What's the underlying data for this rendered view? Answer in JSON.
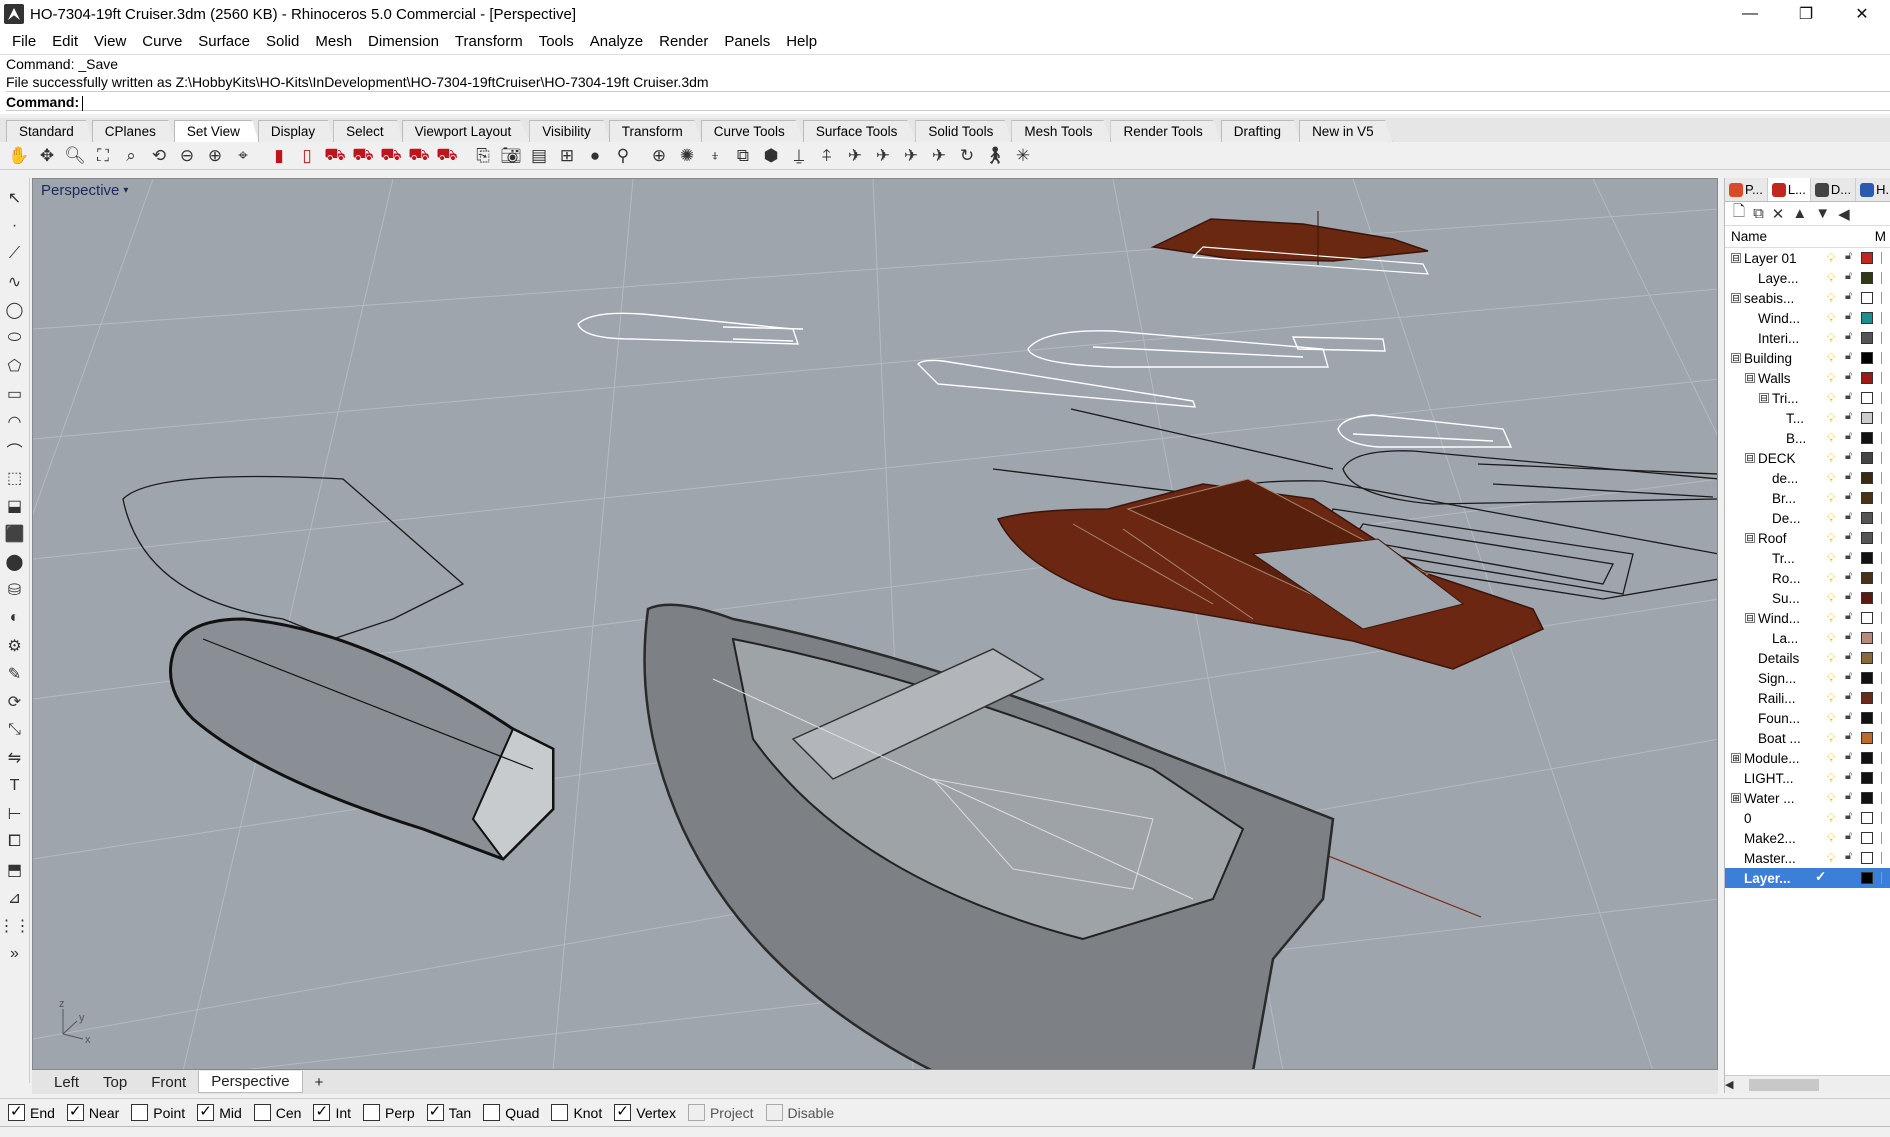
{
  "window": {
    "title": "HO-7304-19ft Cruiser.3dm (2560 KB) - Rhinoceros 5.0 Commercial - [Perspective]",
    "minimize": "—",
    "maximize": "❐",
    "close": "✕"
  },
  "menu": [
    "File",
    "Edit",
    "View",
    "Curve",
    "Surface",
    "Solid",
    "Mesh",
    "Dimension",
    "Transform",
    "Tools",
    "Analyze",
    "Render",
    "Panels",
    "Help"
  ],
  "command": {
    "history_1": "Command: _Save",
    "history_2": "File successfully written as Z:\\HobbyKits\\HO-Kits\\InDevelopment\\HO-7304-19ftCruiser\\HO-7304-19ft Cruiser.3dm",
    "prompt": "Command:"
  },
  "toolbar_tabs": [
    "Standard",
    "CPlanes",
    "Set View",
    "Display",
    "Select",
    "Viewport Layout",
    "Visibility",
    "Transform",
    "Curve Tools",
    "Surface Tools",
    "Solid Tools",
    "Mesh Tools",
    "Render Tools",
    "Drafting",
    "New in V5"
  ],
  "active_toolbar_tab": "Set View",
  "viewport": {
    "title": "Perspective",
    "dropdown": "▾"
  },
  "view_tabs": [
    "Left",
    "Top",
    "Front",
    "Perspective",
    "+"
  ],
  "active_view_tab": "Perspective",
  "osnaps": [
    {
      "label": "End",
      "checked": true
    },
    {
      "label": "Near",
      "checked": true
    },
    {
      "label": "Point",
      "checked": false
    },
    {
      "label": "Mid",
      "checked": true
    },
    {
      "label": "Cen",
      "checked": false
    },
    {
      "label": "Int",
      "checked": true
    },
    {
      "label": "Perp",
      "checked": false
    },
    {
      "label": "Tan",
      "checked": true
    },
    {
      "label": "Quad",
      "checked": false
    },
    {
      "label": "Knot",
      "checked": false
    },
    {
      "label": "Vertex",
      "checked": true
    },
    {
      "label": "Project",
      "checked": false
    },
    {
      "label": "Disable",
      "checked": false
    }
  ],
  "panel": {
    "tabs": [
      "P...",
      "L...",
      "D...",
      "H..."
    ],
    "header_name": "Name",
    "header_m": "M",
    "layers": [
      {
        "name": "Layer 01",
        "level": 0,
        "expander": "⊟",
        "color": "#c0281e"
      },
      {
        "name": "Laye...",
        "level": 1,
        "expander": "",
        "color": "#2f3a12"
      },
      {
        "name": "seabis...",
        "level": 0,
        "expander": "⊟",
        "color": "#ffffff"
      },
      {
        "name": "Wind...",
        "level": 1,
        "expander": "",
        "color": "#1a8f8f"
      },
      {
        "name": "Interi...",
        "level": 1,
        "expander": "",
        "color": "#555555"
      },
      {
        "name": "Building",
        "level": 0,
        "expander": "⊟",
        "color": "#000000"
      },
      {
        "name": "Walls",
        "level": 1,
        "expander": "⊟",
        "color": "#9a1a12"
      },
      {
        "name": "Tri...",
        "level": 2,
        "expander": "⊟",
        "color": "#ffffff"
      },
      {
        "name": "T...",
        "level": 3,
        "expander": "",
        "color": "#cccccc"
      },
      {
        "name": "B...",
        "level": 3,
        "expander": "",
        "color": "#111111"
      },
      {
        "name": "DECK",
        "level": 1,
        "expander": "⊟",
        "color": "#444444"
      },
      {
        "name": "de...",
        "level": 2,
        "expander": "",
        "color": "#3a2a10"
      },
      {
        "name": "Br...",
        "level": 2,
        "expander": "",
        "color": "#4a3014"
      },
      {
        "name": "De...",
        "level": 2,
        "expander": "",
        "color": "#555555"
      },
      {
        "name": "Roof",
        "level": 1,
        "expander": "⊟",
        "color": "#555555"
      },
      {
        "name": "Tr...",
        "level": 2,
        "expander": "",
        "color": "#111111"
      },
      {
        "name": "Ro...",
        "level": 2,
        "expander": "",
        "color": "#4a3014"
      },
      {
        "name": "Su...",
        "level": 2,
        "expander": "",
        "color": "#5a1a10"
      },
      {
        "name": "Wind...",
        "level": 1,
        "expander": "⊟",
        "color": "#ffffff"
      },
      {
        "name": "La...",
        "level": 2,
        "expander": "",
        "color": "#b88a7a"
      },
      {
        "name": "Details",
        "level": 1,
        "expander": "",
        "color": "#8a6a3a"
      },
      {
        "name": "Sign...",
        "level": 1,
        "expander": "",
        "color": "#111111"
      },
      {
        "name": "Raili...",
        "level": 1,
        "expander": "",
        "color": "#6a2a1a"
      },
      {
        "name": "Foun...",
        "level": 1,
        "expander": "",
        "color": "#111111"
      },
      {
        "name": "Boat ...",
        "level": 1,
        "expander": "",
        "color": "#c06a2a"
      },
      {
        "name": "Module...",
        "level": 0,
        "expander": "⊞",
        "color": "#111111"
      },
      {
        "name": "LIGHT...",
        "level": 0,
        "expander": "",
        "color": "#111111"
      },
      {
        "name": "Water ...",
        "level": 0,
        "expander": "⊞",
        "color": "#111111"
      },
      {
        "name": "0",
        "level": 0,
        "expander": "",
        "color": "#ffffff"
      },
      {
        "name": "Make2...",
        "level": 0,
        "expander": "",
        "color": "#ffffff"
      },
      {
        "name": "Master...",
        "level": 0,
        "expander": "",
        "color": "#ffffff"
      },
      {
        "name": "Layer...",
        "level": 0,
        "expander": "",
        "color": "#000000",
        "current": true,
        "check": "✓"
      }
    ]
  },
  "icons": {
    "top_toolbar": [
      "pan-icon",
      "zoom-icon",
      "zoom-window-icon",
      "zoom-extents-icon",
      "zoom-selected-icon",
      "rotate-view-icon",
      "zoom-out-icon",
      "zoom-1to1-icon",
      "zoom-target-icon"
    ],
    "left_toolbar": [
      "select-icon",
      "point-icon",
      "polyline-icon",
      "curve-icon",
      "circle-icon",
      "ellipse-icon",
      "polygon-icon",
      "rectangle-icon",
      "arc-icon",
      "fillet-icon",
      "surface-icon",
      "extrude-icon",
      "box-icon",
      "sphere-icon",
      "cylinder-icon",
      "boolean-icon",
      "gear-icon",
      "move-icon",
      "rotate-icon",
      "scale-icon",
      "mirror-icon",
      "text-icon",
      "dimension-icon",
      "group-icon",
      "block-icon",
      "analyze-icon",
      "grid-icon"
    ]
  }
}
